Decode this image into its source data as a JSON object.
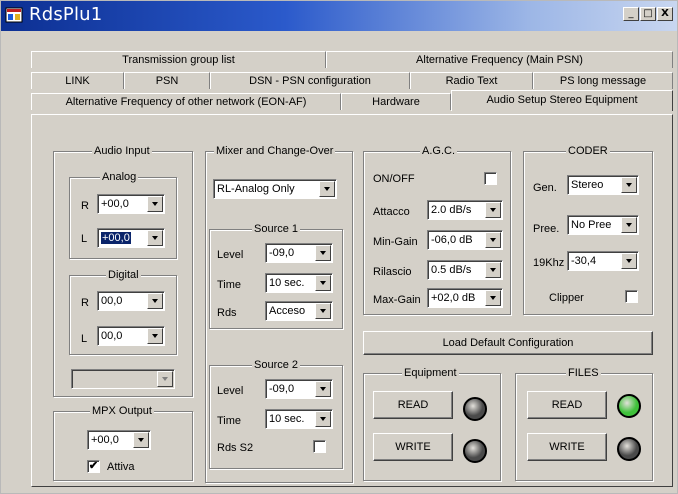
{
  "window": {
    "title": "RdsPlu1",
    "minimize": "_",
    "maximize": "□",
    "close": "X"
  },
  "tabs": {
    "row1": [
      "Transmission group list",
      "Alternative Frequency (Main PSN)"
    ],
    "row2": [
      "LINK",
      "PSN",
      "DSN - PSN configuration",
      "Radio Text",
      "PS long message"
    ],
    "row3": [
      "Alternative Frequency of other network (EON-AF)",
      "Hardware",
      "Audio Setup Stereo Equipment"
    ],
    "active": "Audio Setup Stereo Equipment"
  },
  "audio_input": {
    "title": "Audio Input",
    "analog": {
      "title": "Analog",
      "r_label": "R",
      "r_value": "+00,0",
      "l_label": "L",
      "l_value": "+00,0"
    },
    "digital": {
      "title": "Digital",
      "r_label": "R",
      "r_value": "00,0",
      "l_label": "L",
      "l_value": "00,0"
    },
    "extra_select": ""
  },
  "mpx_output": {
    "title": "MPX Output",
    "value": "+00,0",
    "attiva_label": "Attiva",
    "attiva_checked": true
  },
  "mixer": {
    "title": "Mixer and Change-Over",
    "mode": "RL-Analog Only",
    "source1": {
      "title": "Source 1",
      "level_label": "Level",
      "level": "-09,0",
      "time_label": "Time",
      "time": "10 sec.",
      "rds_label": "Rds",
      "rds": "Acceso"
    },
    "source2": {
      "title": "Source 2",
      "level_label": "Level",
      "level": "-09,0",
      "time_label": "Time",
      "time": "10 sec.",
      "rds_label": "Rds S2",
      "rds_checked": false
    }
  },
  "agc": {
    "title": "A.G.C.",
    "onoff_label": "ON/OFF",
    "onoff_checked": false,
    "attacco_label": "Attacco",
    "attacco": "2.0 dB/s",
    "mingain_label": "Min-Gain",
    "mingain": "-06,0 dB",
    "rilascio_label": "Rilascio",
    "rilascio": "0.5 dB/s",
    "maxgain_label": "Max-Gain",
    "maxgain": "+02,0 dB"
  },
  "coder": {
    "title": "CODER",
    "gen_label": "Gen.",
    "gen": "Stereo",
    "pree_label": "Pree.",
    "pree": "No Pree",
    "khz_label": "19Khz",
    "khz": "-30,4",
    "clipper_label": "Clipper",
    "clipper_checked": false
  },
  "load_default_label": "Load Default Configuration",
  "equipment": {
    "title": "Equipment",
    "read_label": "READ",
    "write_label": "WRITE",
    "read_led_color": "#4a4a4a",
    "write_led_color": "#4a4a4a"
  },
  "files": {
    "title": "FILES",
    "read_label": "READ",
    "write_label": "WRITE",
    "read_led_color": "#3fc13a",
    "write_led_color": "#4a4a4a"
  }
}
